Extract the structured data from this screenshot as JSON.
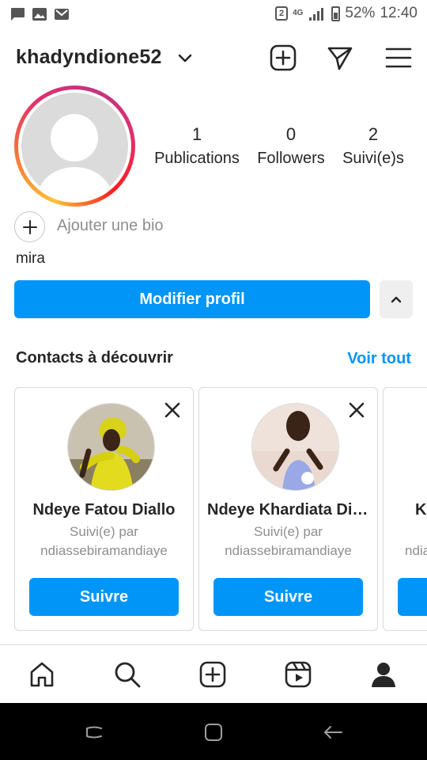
{
  "status_bar": {
    "badge": "2",
    "network": "4G",
    "battery": "52%",
    "time": "12:40",
    "icons": [
      "message-icon",
      "image-icon",
      "gmail-icon"
    ]
  },
  "header": {
    "username": "khadyndione52"
  },
  "profile": {
    "stats": [
      {
        "value": "1",
        "label": "Publications"
      },
      {
        "value": "0",
        "label": "Followers"
      },
      {
        "value": "2",
        "label": "Suivi(e)s"
      }
    ],
    "bio_placeholder": "Ajouter une bio",
    "display_name": "mira",
    "edit_label": "Modifier profil"
  },
  "discover": {
    "title": "Contacts à découvrir",
    "see_all": "Voir tout",
    "cards": [
      {
        "name": "Ndeye Fatou Diallo",
        "sub1": "Suivi(e) par",
        "sub2": "ndiassebiramandiaye",
        "follow_label": "Suivre"
      },
      {
        "name": "Ndeye Khardiata Diop",
        "sub1": "Suivi(e) par",
        "sub2": "ndiassebiramandiaye",
        "follow_label": "Suivre"
      },
      {
        "name": "K",
        "sub1": "",
        "sub2": "ndia",
        "follow_label": ""
      }
    ]
  },
  "colors": {
    "accent": "#0095f6",
    "text": "#262626",
    "muted": "#8e8e8e",
    "border": "#dbdbdb"
  }
}
